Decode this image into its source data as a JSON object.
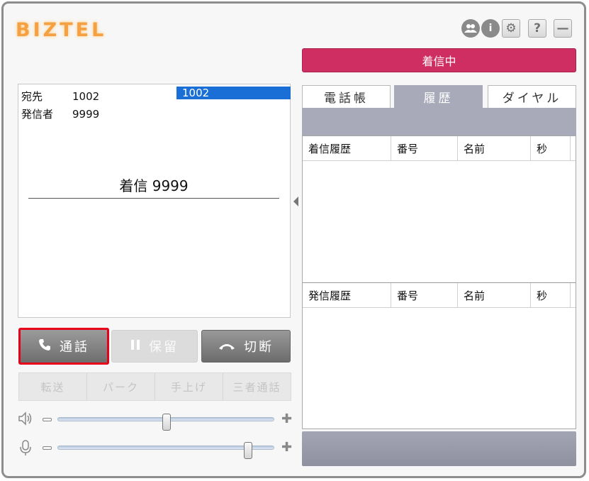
{
  "app": {
    "logo": "BIZTEL"
  },
  "toolbar": {
    "users_icon": "users-icon",
    "info_glyph": "i",
    "settings_glyph": "⚙",
    "help_glyph": "?",
    "minimize_glyph": "—"
  },
  "status": {
    "text": "着信中",
    "color": "#cf2e63"
  },
  "call_info": {
    "dest_label": "宛先",
    "dest_value": "1002",
    "caller_label": "発信者",
    "caller_value": "9999",
    "line_badge": "1002",
    "state_text": "着信 9999"
  },
  "actions": {
    "answer": "通話",
    "hold": "保留",
    "hangup": "切断"
  },
  "sub_actions": [
    "転送",
    "パーク",
    "手上げ",
    "三者通話"
  ],
  "volume": {
    "speaker_level": 0.5,
    "mic_level": 0.89
  },
  "tabs": {
    "phonebook": "電話帳",
    "history": "履歴",
    "dial": "ダイヤル",
    "active": "history"
  },
  "history": {
    "incoming": {
      "headers": [
        "着信履歴",
        "番号",
        "名前",
        "秒"
      ]
    },
    "outgoing": {
      "headers": [
        "発信履歴",
        "番号",
        "名前",
        "秒"
      ]
    }
  }
}
